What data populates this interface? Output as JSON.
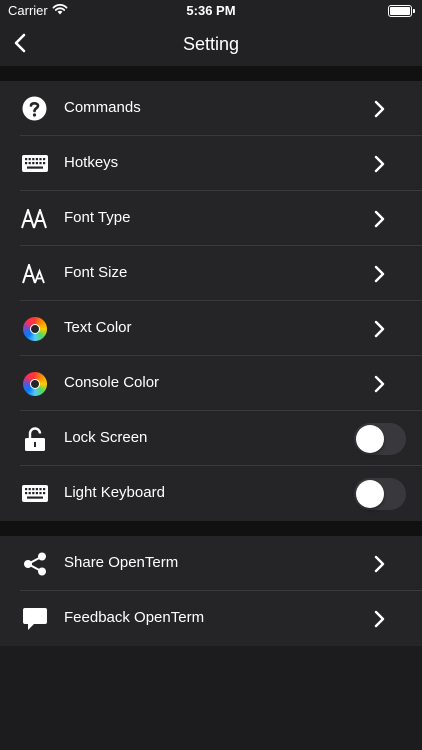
{
  "status_bar": {
    "carrier": "Carrier",
    "time": "5:36 PM"
  },
  "nav": {
    "title": "Setting",
    "back_icon": "chevron-left-icon"
  },
  "settings_group": [
    {
      "label": "Commands",
      "icon": "question-circle-icon",
      "control": "chevron"
    },
    {
      "label": "Hotkeys",
      "icon": "keyboard-icon",
      "control": "chevron"
    },
    {
      "label": "Font Type",
      "icon": "font-type-icon",
      "control": "chevron"
    },
    {
      "label": "Font Size",
      "icon": "font-size-icon",
      "control": "chevron"
    },
    {
      "label": "Text Color",
      "icon": "color-wheel-icon",
      "control": "chevron"
    },
    {
      "label": "Console Color",
      "icon": "color-wheel-icon",
      "control": "chevron"
    },
    {
      "label": "Lock Screen",
      "icon": "unlock-icon",
      "control": "toggle",
      "value": false
    },
    {
      "label": "Light Keyboard",
      "icon": "keyboard-icon",
      "control": "toggle",
      "value": false
    }
  ],
  "share_group": [
    {
      "label": "Share OpenTerm",
      "icon": "share-icon",
      "control": "chevron"
    },
    {
      "label": "Feedback OpenTerm",
      "icon": "speech-bubble-icon",
      "control": "chevron"
    }
  ],
  "colors": {
    "background": "#1c1c1e",
    "row_background": "#252527",
    "section_gap": "#111112",
    "separator": "#3a3a3c",
    "toggle_off": "#39393d"
  }
}
